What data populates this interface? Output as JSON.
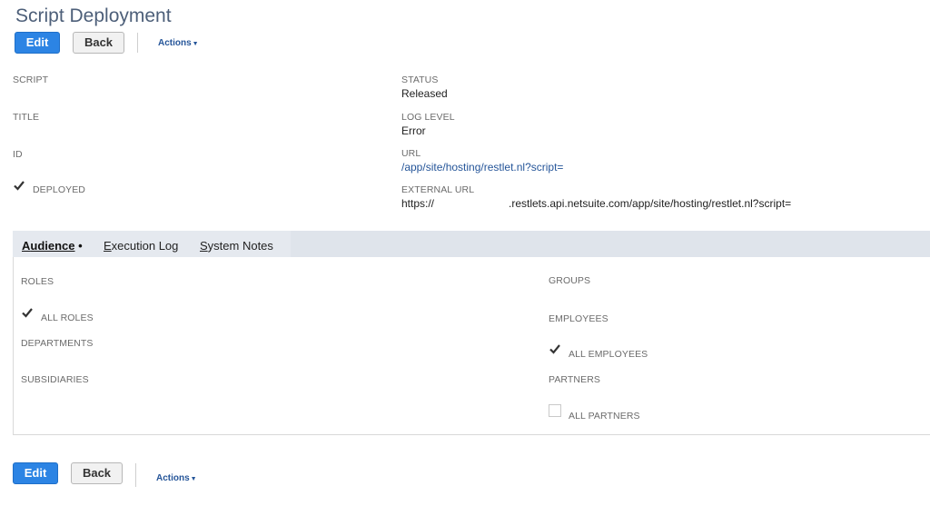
{
  "page": {
    "title": "Script Deployment"
  },
  "toolbar_top": {
    "edit_label": "Edit",
    "back_label": "Back",
    "actions_label": "Actions",
    "actions_arrow": "▼"
  },
  "fields_left": {
    "script_label": "SCRIPT",
    "title_label": "TITLE",
    "id_label": "ID",
    "deployed_label": "DEPLOYED",
    "deployed_checked": true
  },
  "fields_right": {
    "status_label": "STATUS",
    "status_value": "Released",
    "log_level_label": "LOG LEVEL",
    "log_level_value": "Error",
    "url_label": "URL",
    "url_value": "/app/site/hosting/restlet.nl?script=",
    "external_url_label": "EXTERNAL URL",
    "external_url_prefix": "https://",
    "external_url_suffix": ".restlets.api.netsuite.com/app/site/hosting/restlet.nl?script="
  },
  "tabs": [
    {
      "accel": "A",
      "rest": "udience",
      "suffix": " •",
      "active": true
    },
    {
      "accel": "E",
      "rest": "xecution Log",
      "suffix": "",
      "active": false
    },
    {
      "accel": "S",
      "rest": "ystem Notes",
      "suffix": "",
      "active": false
    }
  ],
  "audience": {
    "roles_label": "ROLES",
    "all_roles_label": "ALL ROLES",
    "all_roles_checked": true,
    "departments_label": "DEPARTMENTS",
    "subsidiaries_label": "SUBSIDIARIES",
    "groups_label": "GROUPS",
    "employees_label": "EMPLOYEES",
    "all_employees_label": "ALL EMPLOYEES",
    "all_employees_checked": true,
    "partners_label": "PARTNERS",
    "all_partners_label": "ALL PARTNERS",
    "all_partners_checked": false
  },
  "toolbar_bottom": {
    "edit_label": "Edit",
    "back_label": "Back",
    "actions_label": "Actions",
    "actions_arrow": "▼"
  },
  "colors": {
    "primary_button": "#2c84e4",
    "link": "#255599",
    "title": "#4d5f79",
    "tab_bar": "#e5e9ef"
  }
}
